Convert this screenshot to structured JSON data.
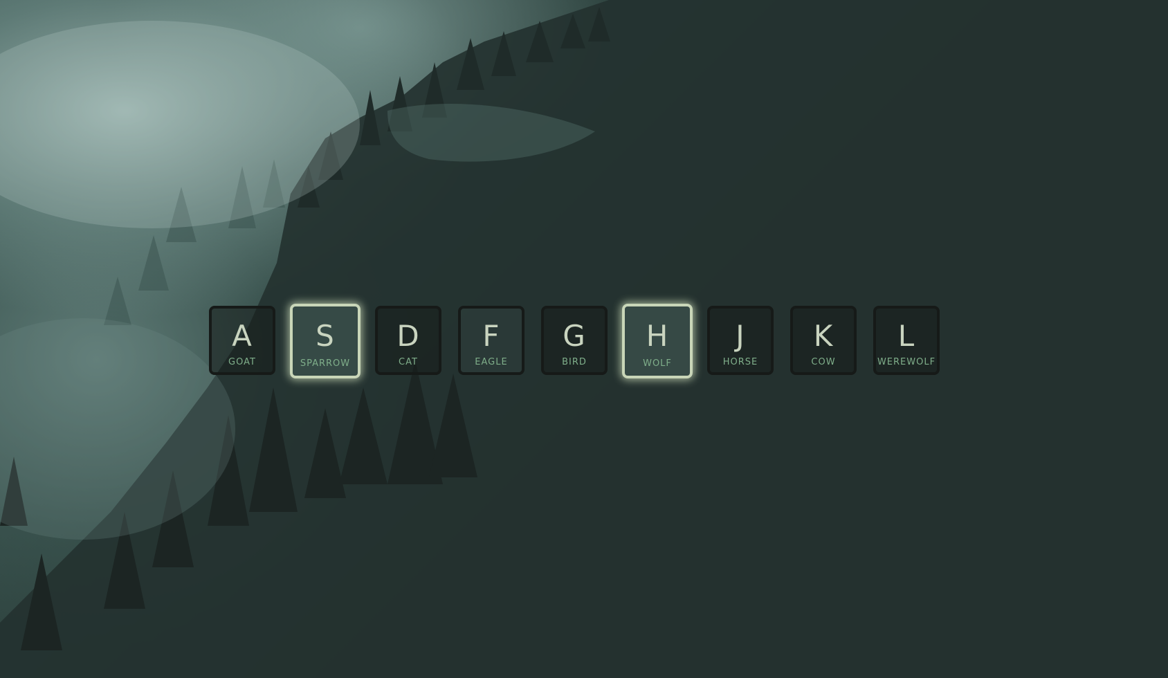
{
  "keys": [
    {
      "key": "A",
      "sound": "GOAT"
    },
    {
      "key": "S",
      "sound": "SPARROW"
    },
    {
      "key": "D",
      "sound": "CAT"
    },
    {
      "key": "F",
      "sound": "EAGLE"
    },
    {
      "key": "G",
      "sound": "BIRD"
    },
    {
      "key": "H",
      "sound": "WOLF"
    },
    {
      "key": "J",
      "sound": "HORSE"
    },
    {
      "key": "K",
      "sound": "COW"
    },
    {
      "key": "L",
      "sound": "WEREWOLF"
    }
  ],
  "colors": {
    "background": "#2a2f2b",
    "key_letter": "#c9d4bf",
    "key_sound": "#7fae8a",
    "key_border": "#161a18",
    "active_glow": "#c9d6b8"
  },
  "active_keys": [
    "S",
    "H"
  ]
}
